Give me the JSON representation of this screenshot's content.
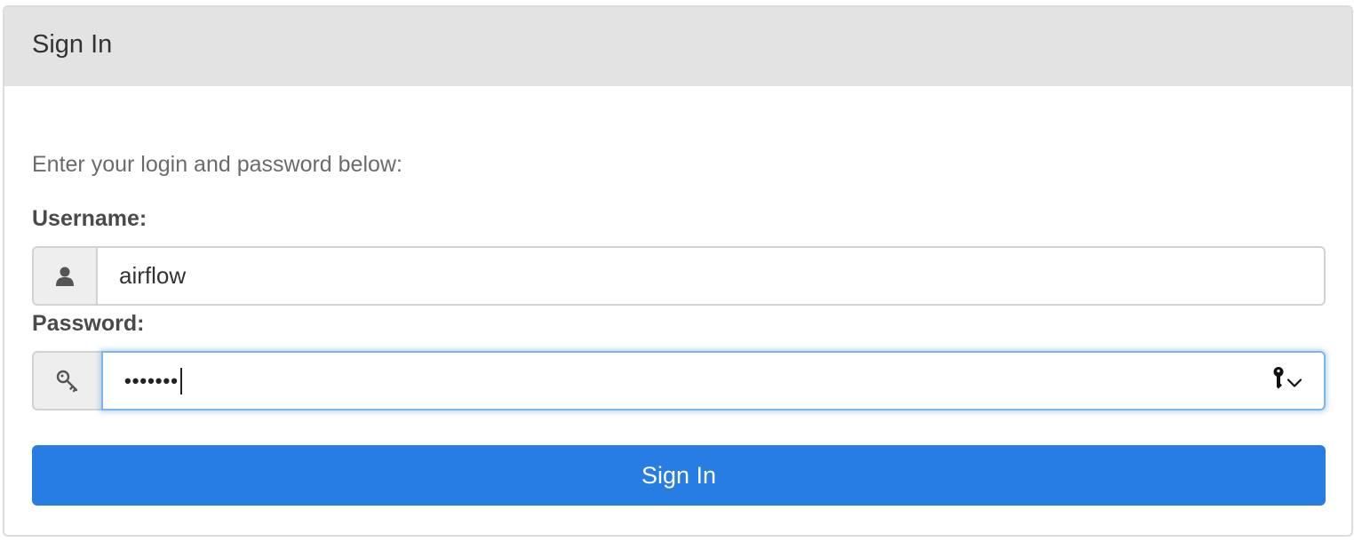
{
  "header": {
    "title": "Sign In"
  },
  "form": {
    "intro": "Enter your login and password below:",
    "username_label": "Username:",
    "username_value": "airflow",
    "password_label": "Password:",
    "password_masked": "•••••••",
    "submit_label": "Sign In"
  },
  "icons": {
    "username": "user-icon",
    "password": "key-icon",
    "password_manager": "key-fill-icon",
    "dropdown": "chevron-down-icon"
  },
  "colors": {
    "header_bg": "#e3e3e3",
    "button_bg": "#277de3",
    "focus_border": "#7fb3ea"
  }
}
